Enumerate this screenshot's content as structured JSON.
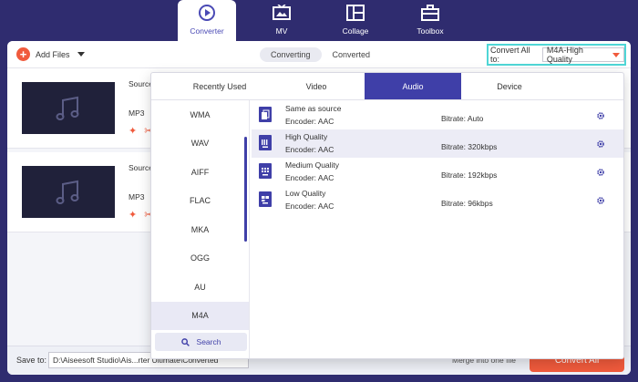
{
  "nav": {
    "tabs": [
      {
        "label": "Converter",
        "icon": "converter-icon"
      },
      {
        "label": "MV",
        "icon": "mv-icon"
      },
      {
        "label": "Collage",
        "icon": "collage-icon"
      },
      {
        "label": "Toolbox",
        "icon": "toolbox-icon"
      }
    ],
    "active": "Converter"
  },
  "toolbar": {
    "add_files": "Add Files",
    "seg_converting": "Converting",
    "seg_converted": "Converted",
    "convert_all_label": "Convert All to:",
    "convert_all_value": "M4A-High Quality"
  },
  "files": [
    {
      "source": "Source",
      "format": "MP3"
    },
    {
      "source": "Source",
      "format": "MP3"
    }
  ],
  "dropdown": {
    "tabs": [
      "Recently Used",
      "Video",
      "Audio",
      "Device"
    ],
    "active_tab": "Audio",
    "formats": [
      "WMA",
      "WAV",
      "AIFF",
      "FLAC",
      "MKA",
      "OGG",
      "AU",
      "M4A"
    ],
    "active_format": "M4A",
    "search_label": "Search",
    "presets": [
      {
        "name": "Same as source",
        "encoder": "Encoder: AAC",
        "bitrate": "Bitrate: Auto"
      },
      {
        "name": "High Quality",
        "encoder": "Encoder: AAC",
        "bitrate": "Bitrate: 320kbps"
      },
      {
        "name": "Medium Quality",
        "encoder": "Encoder: AAC",
        "bitrate": "Bitrate: 192kbps"
      },
      {
        "name": "Low Quality",
        "encoder": "Encoder: AAC",
        "bitrate": "Bitrate: 96kbps"
      }
    ],
    "active_preset": "High Quality"
  },
  "bottom": {
    "save_to_label": "Save to:",
    "save_path": "D:\\Aiseesoft Studio\\Ais...rter Ultimate\\Converted",
    "merge_label": "Merge into one file",
    "convert_all_button": "Convert All"
  },
  "colors": {
    "nav_bg": "#2f2c6f",
    "accent": "#3f3fa8",
    "orange": "#f05a3c",
    "highlight": "#4fd6d6"
  }
}
